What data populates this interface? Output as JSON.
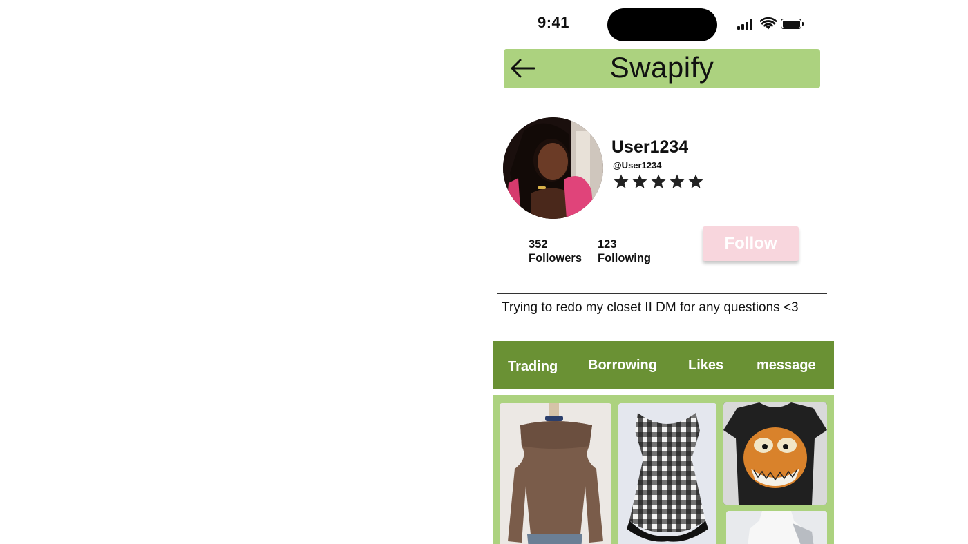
{
  "status_bar": {
    "time": "9:41",
    "icons": [
      "cellular-signal-icon",
      "wifi-icon",
      "battery-icon"
    ]
  },
  "header": {
    "title": "Swapify",
    "back_icon": "arrow-left-icon"
  },
  "profile": {
    "username": "User1234",
    "handle": "@User1234",
    "rating": 5,
    "followers_count": "352",
    "followers_label": "Followers",
    "following_count": "123",
    "following_label": "Following",
    "follow_label": "Follow",
    "bio": "Trying to redo my closet II DM for any questions <3"
  },
  "tabs": [
    {
      "label": "Trading"
    },
    {
      "label": "Borrowing"
    },
    {
      "label": "Likes"
    },
    {
      "label": "message"
    }
  ],
  "items": [
    {
      "name": "brown off-shoulder sweater"
    },
    {
      "name": "black and white plaid dress"
    },
    {
      "name": "garfield graphic t-shirt"
    },
    {
      "name": "white top on mannequin"
    }
  ],
  "colors": {
    "header_bg": "#acd27f",
    "tabbar_bg": "#6a9134",
    "follow_bg": "#f8d6dd",
    "grid_bg": "#acd27f"
  }
}
